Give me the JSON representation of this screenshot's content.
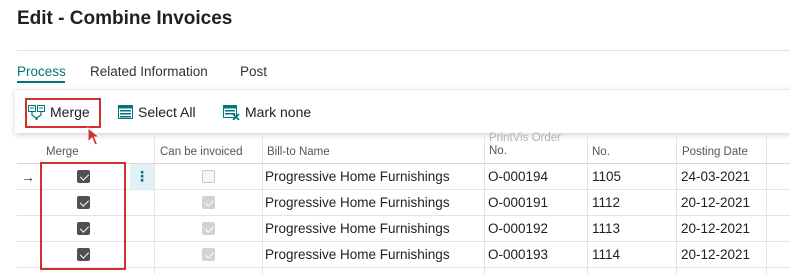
{
  "page": {
    "title": "Edit - Combine Invoices"
  },
  "tabs": [
    {
      "label": "Process",
      "active": true
    },
    {
      "label": "Related Information",
      "active": false
    },
    {
      "label": "Post",
      "active": false
    }
  ],
  "actions": [
    {
      "label": "Merge",
      "icon": "merge-icon"
    },
    {
      "label": "Select All",
      "icon": "select-all-icon"
    },
    {
      "label": "Mark none",
      "icon": "mark-none-icon"
    }
  ],
  "columns": {
    "merge": "Merge",
    "can_be_invoiced": "Can be invoiced",
    "bill_to_name": "Bill-to Name",
    "printvis_order_no_line1": "PrintVis Order",
    "printvis_order_no_line2": "No.",
    "no": "No.",
    "posting_date": "Posting Date"
  },
  "rows": [
    {
      "current": true,
      "merge": true,
      "can_be_invoiced": false,
      "bill_to_name": "Progressive Home Furnishings",
      "printvis_order_no": "O-000194",
      "no": "1105",
      "posting_date": "24-03-2021"
    },
    {
      "current": false,
      "merge": true,
      "can_be_invoiced": true,
      "bill_to_name": "Progressive Home Furnishings",
      "printvis_order_no": "O-000191",
      "no": "1112",
      "posting_date": "20-12-2021"
    },
    {
      "current": false,
      "merge": true,
      "can_be_invoiced": true,
      "bill_to_name": "Progressive Home Furnishings",
      "printvis_order_no": "O-000192",
      "no": "1113",
      "posting_date": "20-12-2021"
    },
    {
      "current": false,
      "merge": true,
      "can_be_invoiced": true,
      "bill_to_name": "Progressive Home Furnishings",
      "printvis_order_no": "O-000193",
      "no": "1114",
      "posting_date": "20-12-2021"
    }
  ],
  "colors": {
    "accent": "#00757a",
    "highlight": "#d0312d"
  }
}
